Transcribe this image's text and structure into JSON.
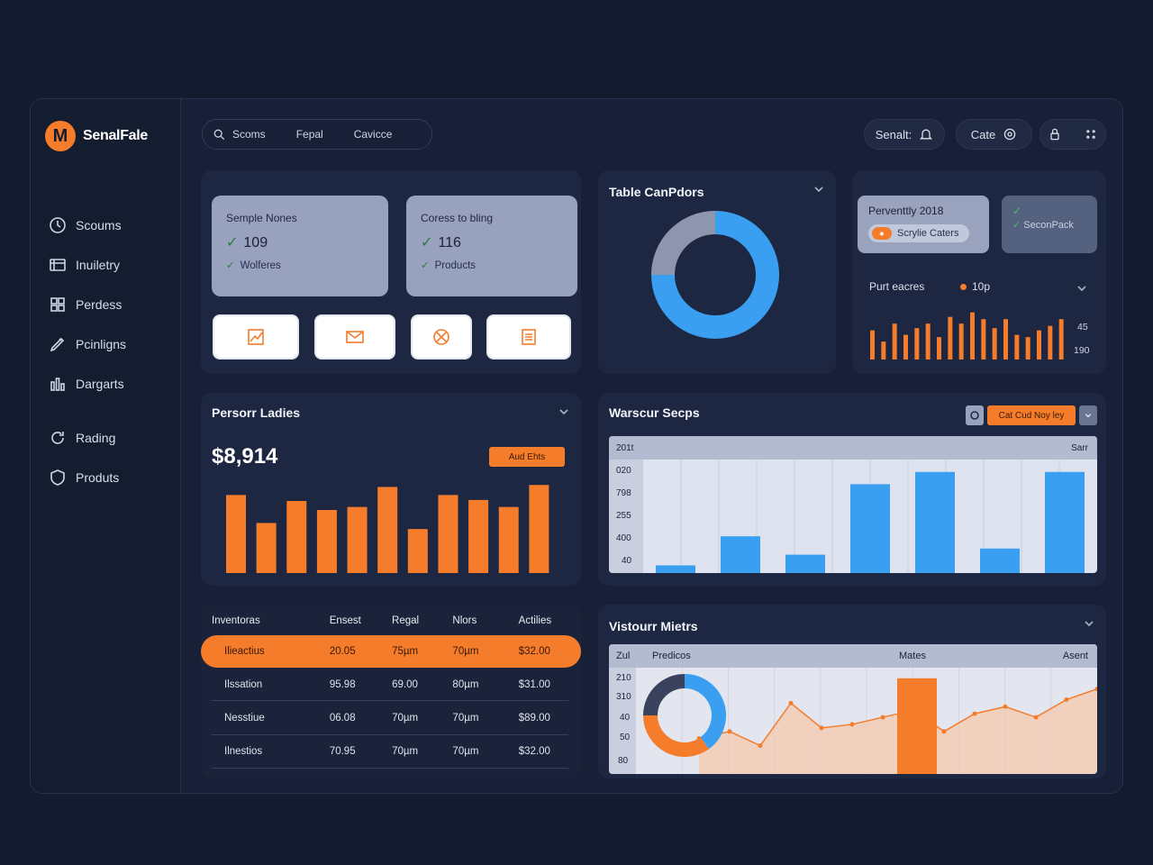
{
  "brand": {
    "name": "SenalFale"
  },
  "sidebar": {
    "items": [
      {
        "label": "Scoums",
        "icon": "clock-icon"
      },
      {
        "label": "Inuiletry",
        "icon": "inventory-icon"
      },
      {
        "label": "Perdess",
        "icon": "grid-icon"
      },
      {
        "label": "Pcinligns",
        "icon": "pen-icon"
      },
      {
        "label": "Dargarts",
        "icon": "chart-icon"
      },
      {
        "label": "Rading",
        "icon": "refresh-icon"
      },
      {
        "label": "Produts",
        "icon": "shield-icon"
      }
    ]
  },
  "topbar": {
    "search_segments": [
      "Scoms",
      "Fepal",
      "Cavicce"
    ],
    "pill_search": "Senalt:",
    "pill_cate": "Cate"
  },
  "overview": {
    "stats": [
      {
        "title": "Semple Nones",
        "value": "109",
        "sub": "Wolferes"
      },
      {
        "title": "Coress to bling",
        "value": "116",
        "sub": "Products"
      }
    ],
    "actions": [
      "chart-icon",
      "mail-icon",
      "settings-icon",
      "document-icon"
    ]
  },
  "donut_card": {
    "title": "Table CanPdors",
    "chart_data": {
      "type": "pie",
      "title": "Table CanPdors",
      "series": [
        {
          "values": [
            75,
            25
          ]
        }
      ],
      "colors": [
        "#3a9ff0",
        "#8e96ad"
      ]
    }
  },
  "mini_card": {
    "box1_title": "Perventtly 2018",
    "box1_tag": "Scrylie Caters",
    "box2_tag": "SeconPack",
    "label": "Purt eacres",
    "legend": "10p",
    "axis_right": [
      "45",
      "190"
    ],
    "chart_data": {
      "type": "bar",
      "values": [
        26,
        16,
        32,
        22,
        28,
        32,
        20,
        38,
        32,
        42,
        36,
        28,
        36,
        22,
        20,
        26,
        30,
        36
      ],
      "color": "#f47c2b",
      "ylim": [
        0,
        45
      ]
    }
  },
  "persona": {
    "title": "Persorr Ladies",
    "amount": "$8,914",
    "button": "Aud Ehts",
    "chart_data": {
      "type": "bar",
      "values": [
        78,
        50,
        72,
        63,
        66,
        86,
        44,
        78,
        73,
        66,
        88
      ],
      "color": "#f47c2b",
      "ylim": [
        0,
        90
      ]
    }
  },
  "warehouse": {
    "title": "Warscur Secps",
    "button": "Cat Cud Noy ley",
    "corner_left": "201t",
    "corner_right": "Sarr",
    "chart_data": {
      "type": "bar",
      "y_ticks": [
        "020",
        "798",
        "255",
        "400",
        "40"
      ],
      "values": [
        5,
        24,
        12,
        58,
        66,
        16,
        66
      ],
      "color": "#3a9ff0",
      "ylim": [
        0,
        100
      ]
    }
  },
  "inventory": {
    "headers": [
      "Inventoras",
      "Ensest",
      "Regal",
      "Nlors",
      "Actilies"
    ],
    "rows": [
      [
        "Ilieactius",
        "20.05",
        "75µm",
        "70µm",
        "$32.00"
      ],
      [
        "Ilssation",
        "95.98",
        "69.00",
        "80µm",
        "$31.00"
      ],
      [
        "Nesstiue",
        "06.08",
        "70µm",
        "70µm",
        "$89.00"
      ],
      [
        "Ilnestios",
        "70.95",
        "70µm",
        "70µm",
        "$32.00"
      ]
    ]
  },
  "visitor": {
    "title": "Vistourr Mietrs",
    "header": [
      "Zul",
      "Predicos",
      "Mates",
      "Asent"
    ],
    "y_ticks": [
      "210",
      "310",
      "40",
      "50",
      "80"
    ],
    "chart_data": {
      "type": "line",
      "values": [
        50,
        54,
        46,
        70,
        56,
        58,
        62,
        66,
        54,
        64,
        68,
        62,
        72,
        78
      ],
      "color": "#f47c2b",
      "bar_value": 72,
      "donut_values": [
        40,
        35,
        25
      ],
      "donut_colors": [
        "#3a9ff0",
        "#f47c2b",
        "#39435e"
      ]
    }
  }
}
